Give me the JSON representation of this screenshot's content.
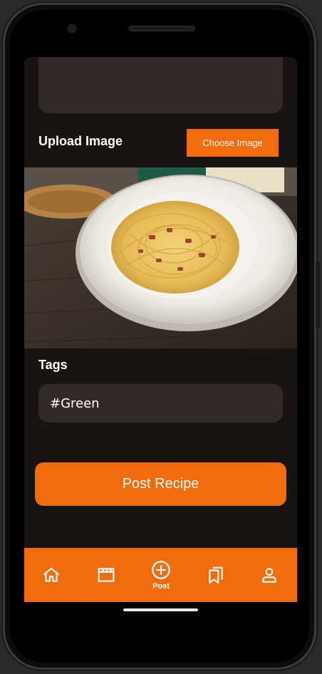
{
  "form": {
    "upload_label": "Upload Image",
    "choose_image_label": "Choose Image",
    "tags_label": "Tags",
    "tags_value": "#Green",
    "post_button_label": "Post Recipe"
  },
  "nav": {
    "items": [
      {
        "icon": "home-icon",
        "label": ""
      },
      {
        "icon": "clapperboard-icon",
        "label": ""
      },
      {
        "icon": "plus-circle-icon",
        "label": "Post"
      },
      {
        "icon": "bookmarks-icon",
        "label": ""
      },
      {
        "icon": "person-icon",
        "label": ""
      }
    ]
  },
  "colors": {
    "accent": "#f06c0c",
    "background": "#181412",
    "field": "#322a26"
  }
}
